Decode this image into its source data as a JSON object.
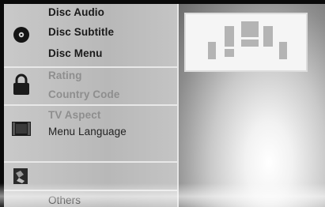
{
  "menu": {
    "sections": [
      {
        "icon": "disc-icon",
        "items": [
          {
            "label": "Disc Audio",
            "state": "active"
          },
          {
            "label": "Disc Subtitle",
            "state": "active"
          },
          {
            "label": "Disc Menu",
            "state": "active"
          }
        ]
      },
      {
        "icon": "padlock-icon",
        "items": [
          {
            "label": "Rating",
            "state": "dim"
          },
          {
            "label": "Country Code",
            "state": "dim"
          }
        ]
      },
      {
        "icon": "tv-screen-icon",
        "items": [
          {
            "label": "TV Aspect",
            "state": "dim"
          },
          {
            "label": "Menu Language",
            "state": "mid"
          }
        ]
      },
      {
        "icon": "speaker-icon",
        "items": []
      },
      {
        "icon": "",
        "items": [
          {
            "label": "Others",
            "state": "mid"
          }
        ]
      }
    ]
  },
  "preview": {
    "icon": "speaker-layout-icon"
  }
}
